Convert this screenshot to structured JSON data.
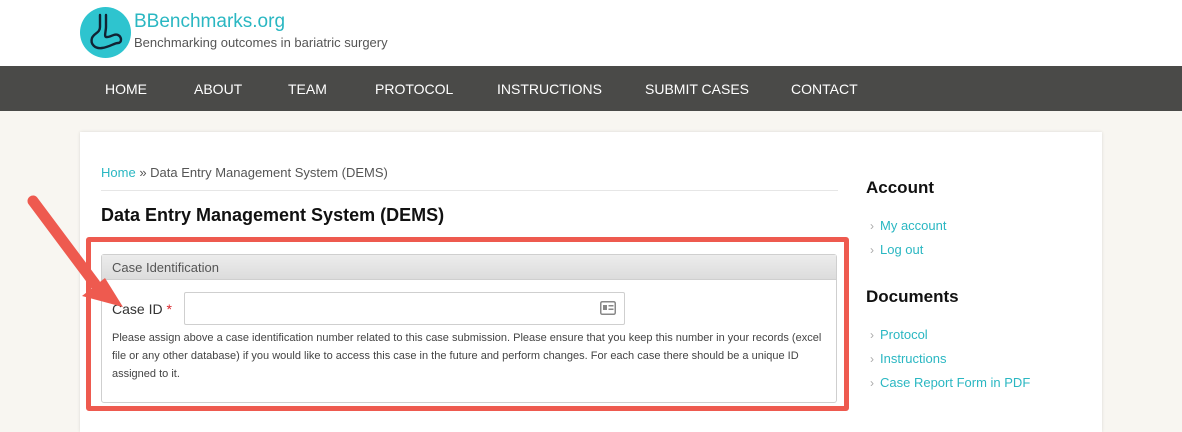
{
  "site": {
    "name": "BBenchmarks.org",
    "slogan": "Benchmarking outcomes in bariatric surgery"
  },
  "nav": {
    "items": [
      "HOME",
      "ABOUT",
      "TEAM",
      "PROTOCOL",
      "INSTRUCTIONS",
      "SUBMIT CASES",
      "CONTACT"
    ]
  },
  "breadcrumb": {
    "home": "Home",
    "separator": "»",
    "current": "Data Entry Management System (DEMS)"
  },
  "page": {
    "title": "Data Entry Management System (DEMS)"
  },
  "form": {
    "legend": "Case Identification",
    "case_id_label": "Case ID",
    "required_mark": "*",
    "case_id_value": "",
    "help_text": "Please assign above a case identification number related to this case submission. Please ensure that you keep this number in your records (excel file or any other database) if you would like to access this case in the future and perform changes. For each case there should be a unique ID assigned to it."
  },
  "sidebar": {
    "account_heading": "Account",
    "account_links": [
      "My account",
      "Log out"
    ],
    "documents_heading": "Documents",
    "document_links": [
      "Protocol",
      "Instructions",
      "Case Report Form in PDF"
    ]
  },
  "colors": {
    "accent": "#2ab7c2",
    "nav_bg": "#4a4a48",
    "highlight": "#ee5a4f",
    "required": "#d9262c"
  },
  "icons": {
    "logo": "stomach-logo-icon",
    "field": "id-card-icon",
    "annotation": "red-arrow-icon",
    "list_bullet": "chevron-right-icon"
  }
}
